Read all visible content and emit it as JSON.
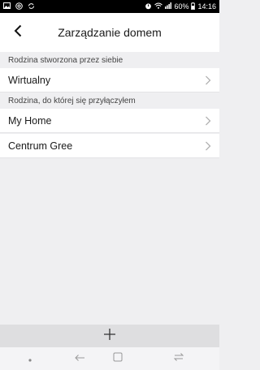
{
  "status_bar": {
    "icons_left": [
      "gallery-icon",
      "at-icon",
      "sync-icon"
    ],
    "battery_percent": "60%",
    "time": "14:16",
    "icons_right": [
      "alarm-icon",
      "wifi-icon",
      "signal-icon",
      "battery-icon"
    ]
  },
  "header": {
    "title": "Zarządzanie domem",
    "back_icon": "chevron-left-icon"
  },
  "sections": {
    "own_family": {
      "header": "Rodzina stworzona przez siebie",
      "items": [
        {
          "label": "Wirtualny"
        }
      ]
    },
    "joined_family": {
      "header": "Rodzina, do której się przyłączyłem",
      "items": [
        {
          "label": "My Home"
        },
        {
          "label": "Centrum Gree"
        }
      ]
    }
  },
  "add_bar": {
    "icon": "plus-icon"
  },
  "nav_bar": {
    "icons": [
      "dot-icon",
      "back-arrow-icon",
      "recents-icon",
      "switch-icon"
    ]
  },
  "colors": {
    "background": "#efeff1",
    "surface": "#ffffff",
    "text": "#1a1a1a",
    "chevron": "#b0b0b0",
    "add_bar": "#dedee0"
  }
}
